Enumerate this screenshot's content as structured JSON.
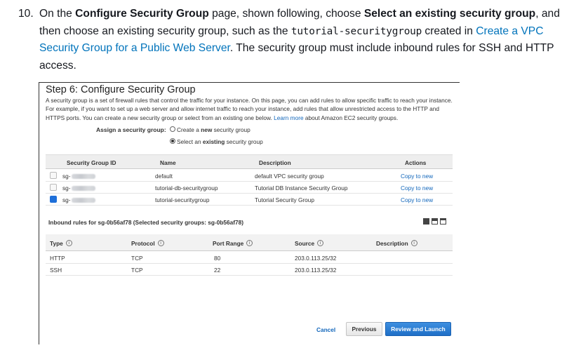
{
  "step": {
    "number": "10.",
    "t1": "On the ",
    "b1": "Configure Security Group",
    "t2": " page, shown following, choose ",
    "b2": "Select an existing security group",
    "t3": ", and then choose an existing security group, such as the ",
    "code": "tutorial-securitygroup",
    "t4": " created in ",
    "link": "Create a VPC Security Group for a Public Web Server",
    "t5": ". The security group must include inbound rules for SSH and HTTP access."
  },
  "wizard": {
    "title": "Step 6: Configure Security Group",
    "description": "A security group is a set of firewall rules that control the traffic for your instance. On this page, you can add rules to allow specific traffic to reach your instance. For example, if you want to set up a web server and allow internet traffic to reach your instance, add rules that allow unrestricted access to the HTTP and HTTPS ports. You can create a new security group or select from an existing one below.",
    "learn_more": "Learn more",
    "description_tail": "about Amazon EC2 security groups.",
    "assign_label": "Assign a security group:",
    "option_new_pre": "Create a ",
    "option_new_bold": "new",
    "option_new_post": " security group",
    "option_existing_pre": "Select an ",
    "option_existing_bold": "existing",
    "option_existing_post": " security group",
    "selected_option": "existing"
  },
  "sg_table": {
    "headers": [
      "Security Group ID",
      "Name",
      "Description",
      "Actions"
    ],
    "rows": [
      {
        "id_prefix": "sg-",
        "name": "default",
        "description": "default VPC security group",
        "action": "Copy to new",
        "checked": false
      },
      {
        "id_prefix": "sg-",
        "name": "tutorial-db-securitygroup",
        "description": "Tutorial DB Instance Security Group",
        "action": "Copy to new",
        "checked": false
      },
      {
        "id_prefix": "sg-",
        "name": "tutorial-securitygroup",
        "description": "Tutorial Security Group",
        "action": "Copy to new",
        "checked": true
      }
    ]
  },
  "inbound": {
    "title": "Inbound rules for sg-0b56af78 (Selected security groups: sg-0b56af78)",
    "headers": [
      "Type",
      "Protocol",
      "Port Range",
      "Source",
      "Description"
    ],
    "info_glyph": "i",
    "rows": [
      {
        "type": "HTTP",
        "protocol": "TCP",
        "port": "80",
        "source": "203.0.113.25/32",
        "description": ""
      },
      {
        "type": "SSH",
        "protocol": "TCP",
        "port": "22",
        "source": "203.0.113.25/32",
        "description": ""
      }
    ]
  },
  "footer": {
    "cancel": "Cancel",
    "previous": "Previous",
    "launch": "Review and Launch"
  },
  "colors": {
    "link": "#0073bb",
    "primary_button": "#1f6fc7",
    "checkbox_checked": "#1e6fd9"
  }
}
